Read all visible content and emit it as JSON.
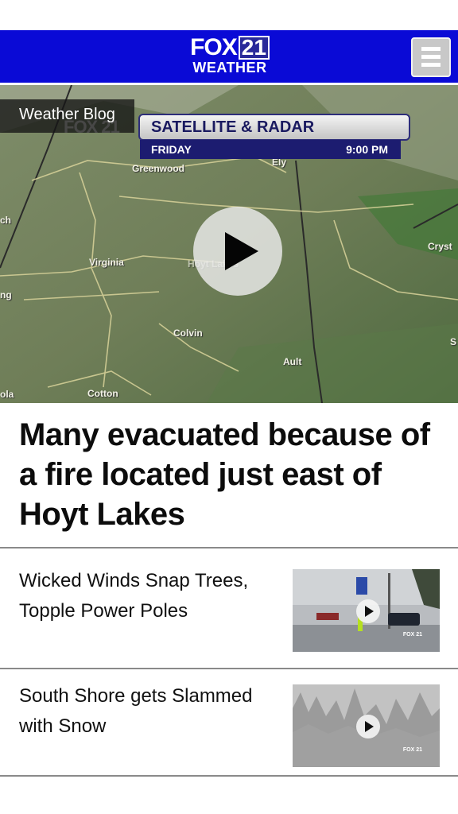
{
  "header": {
    "logo_top": "FOX",
    "logo_number": "21",
    "logo_sub": "WEATHER",
    "menu_icon": "hamburger-menu-icon",
    "brand_color": "#0a0ad6"
  },
  "featured_video": {
    "category_tag": "Weather Blog",
    "graphic_brand": "FOX 21",
    "graphic_title": "SATELLITE & RADAR",
    "graphic_day": "FRIDAY",
    "graphic_time": "9:00 PM",
    "play_icon": "play-icon",
    "map_labels": {
      "greenwood": "Greenwood",
      "ely": "Ely",
      "virginia": "Virginia",
      "hoyt": "Hoyt Lakes",
      "colvin": "Colvin",
      "ault": "Ault",
      "cotton": "Cotton",
      "crystal": "Cryst",
      "ch": "ch",
      "ng": "ng",
      "ola": "ola",
      "s": "S"
    }
  },
  "headline": "Many evacuated because of a fire located just east of Hoyt Lakes",
  "stories": [
    {
      "title": "Wicked Winds Snap Trees, Topple Power Poles",
      "thumb_logo": "FOX 21"
    },
    {
      "title": "South Shore gets Slammed with Snow",
      "thumb_logo": "FOX 21"
    }
  ]
}
